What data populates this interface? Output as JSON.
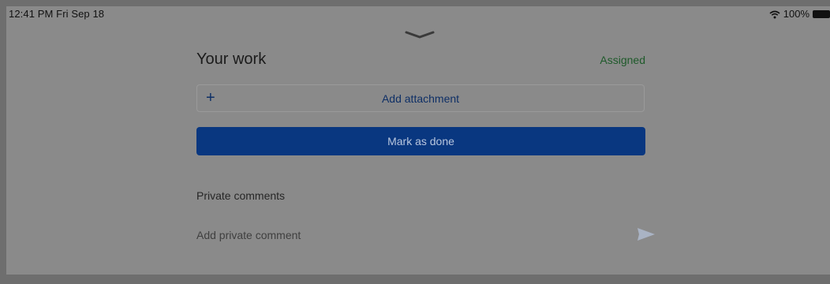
{
  "status_bar": {
    "time": "12:41 PM  Fri Sep 18",
    "battery": "100%",
    "icons": [
      "wifi-icon",
      "battery-icon"
    ]
  },
  "sheet": {
    "title": "Your work",
    "status": "Assigned",
    "add_attachment": {
      "icon": "plus-icon",
      "label": "Add attachment"
    },
    "mark_done_label": "Mark as done",
    "private_comments_label": "Private comments",
    "comment_placeholder": "Add private comment",
    "send_icon": "send-icon"
  },
  "colors": {
    "accent": "#093780",
    "status_green": "#1e5a2a",
    "link_blue": "#0e2f66",
    "scrim": "#8a8a8a"
  }
}
